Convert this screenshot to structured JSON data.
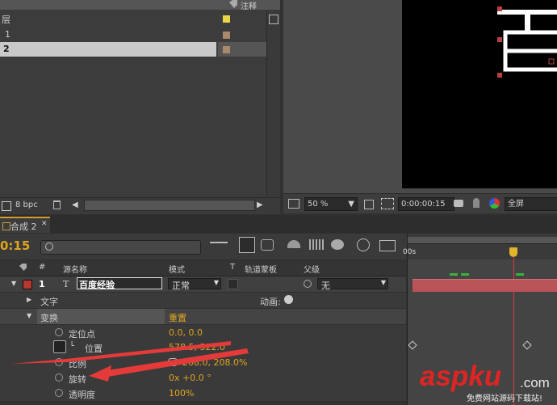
{
  "project": {
    "header_label": "注释",
    "rows": [
      {
        "label": "层",
        "swatch": "#e8d54a"
      },
      {
        "label": "1",
        "swatch": "#a88a6a"
      },
      {
        "label": "2",
        "swatch": "#a88a6a",
        "selected": true
      }
    ],
    "bpc": "8 bpc"
  },
  "viewer": {
    "zoom": "50 %",
    "timecode": "0:00:00:15",
    "resolution": "全屏"
  },
  "timeline": {
    "tab_label": "合成 2",
    "time": "0:15",
    "ruler_start": "00s",
    "columns": {
      "hash": "#",
      "source_name": "源名称",
      "mode": "模式",
      "t": "T",
      "trkmat": "轨道蒙板",
      "parent": "父级"
    },
    "layer": {
      "number": "1",
      "type_icon": "T",
      "name": "百度经验",
      "mode": "正常",
      "parent": "无"
    },
    "rows": [
      {
        "label": "文字",
        "extra": "动画:"
      },
      {
        "label": "变换",
        "value": "重置"
      },
      {
        "label": "定位点",
        "value": "0.0, 0.0"
      },
      {
        "label": "位置",
        "value": "578.5, 322.0"
      },
      {
        "label": "比例",
        "value": "208.0, 208.0%"
      },
      {
        "label": "旋转",
        "value": "0x +0.0 °"
      },
      {
        "label": "透明度",
        "value": "100%"
      }
    ]
  },
  "watermark": {
    "brand": "aspku",
    "tld": ".com",
    "caption": "免费网站源码下载站!"
  },
  "colors": {
    "accent": "#d49a2a",
    "value_orange": "#dfa421",
    "label_red": "#b5392f",
    "arrow_red": "#e43a3a",
    "layer_bar": "#b85458"
  }
}
